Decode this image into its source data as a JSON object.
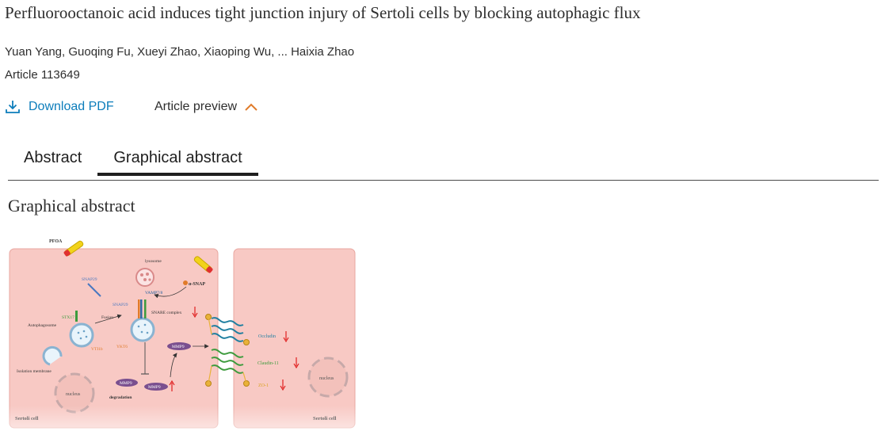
{
  "article": {
    "title": "Perfluorooctanoic acid induces tight junction injury of Sertoli cells by blocking autophagic flux",
    "authors": "Yuan Yang, Guoqing Fu, Xueyi Zhao, Xiaoping Wu, ... Haixia Zhao",
    "article_id": "Article 113649"
  },
  "actions": {
    "download_label": "Download PDF",
    "preview_label": "Article preview"
  },
  "tabs": [
    {
      "label": "Abstract",
      "active": false
    },
    {
      "label": "Graphical abstract",
      "active": true
    }
  ],
  "section": {
    "title": "Graphical abstract"
  },
  "figure": {
    "labels": {
      "pfoa": "PFOA",
      "lysosome": "lysosome",
      "snap29_top": "SNAP29",
      "alpha_snap": "α-SNAP",
      "vamp78": "VAMP7/8",
      "snap29_mid": "SNAP29",
      "stx17": "STX17",
      "fusion": "Fusion",
      "snare_complex": "SNARE complex",
      "autophagosome": "Autophagosome",
      "vti1b": "VTI1b",
      "ykt6": "YKT6",
      "mmp9_mid": "MMP9",
      "isolation_membrane": "Isolation membrane",
      "nucleus_left": "nucleus",
      "mmp9_a": "MMP9",
      "mmp9_b": "MMP9",
      "degradation": "degradation",
      "sertoli_left": "Sertoli cell",
      "occludin": "Occludin",
      "claudin": "Claudin-11",
      "zo1": "ZO-1",
      "nucleus_right": "nucleus",
      "sertoli_right": "Sertoli cell"
    },
    "colors": {
      "cell_fill": "#f8c9c4",
      "cell_border": "#e8a7a0",
      "occludin": "#1f7fa0",
      "claudin": "#3d9b3d",
      "zo1": "#d9a21b",
      "mmp9": "#7a4f8f",
      "arrow_red": "#e02020"
    }
  }
}
